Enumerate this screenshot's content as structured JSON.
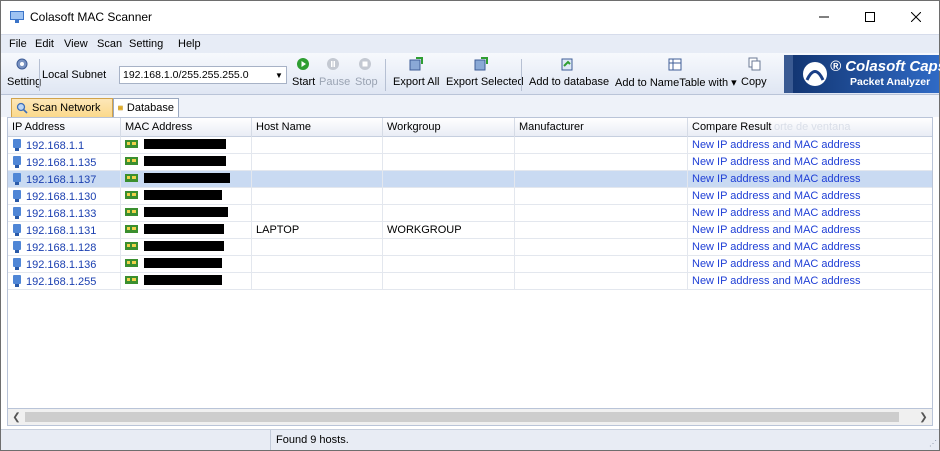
{
  "window": {
    "title": "Colasoft MAC Scanner"
  },
  "menu": [
    "File",
    "Edit",
    "View",
    "Scan",
    "Setting",
    "Help"
  ],
  "toolbar": {
    "setting": "Setting",
    "subnet_label": "Local Subnet",
    "subnet_value": "192.168.1.0/255.255.255.0",
    "start": "Start",
    "pause": "Pause",
    "stop": "Stop",
    "export_all": "Export All",
    "export_selected": "Export Selected",
    "add_db": "Add to database",
    "add_nametable": "Add to NameTable with ▾",
    "copy": "Copy"
  },
  "promo": {
    "brand": "® Colasoft Capsa",
    "tagline": "Packet Analyzer"
  },
  "tabs": [
    "Scan Network",
    "Database"
  ],
  "columns": [
    "IP Address",
    "MAC Address",
    "Host Name",
    "Workgroup",
    "Manufacturer",
    "Compare Result"
  ],
  "ghost_text": "orte de ventana",
  "rows": [
    {
      "ip": "192.168.1.1",
      "mac": "",
      "host": "",
      "workgroup": "",
      "manufacturer": "",
      "compare": "New IP address and MAC address"
    },
    {
      "ip": "192.168.1.135",
      "mac": "",
      "host": "",
      "workgroup": "",
      "manufacturer": "",
      "compare": "New IP address and MAC address"
    },
    {
      "ip": "192.168.1.137",
      "mac": "",
      "host": "",
      "workgroup": "",
      "manufacturer": "",
      "compare": "New IP address and MAC address",
      "selected": true
    },
    {
      "ip": "192.168.1.130",
      "mac": "",
      "host": "",
      "workgroup": "",
      "manufacturer": "",
      "compare": "New IP address and MAC address"
    },
    {
      "ip": "192.168.1.133",
      "mac": "",
      "host": "",
      "workgroup": "",
      "manufacturer": "",
      "compare": "New IP address and MAC address"
    },
    {
      "ip": "192.168.1.131",
      "mac": "",
      "host": "LAPTOP",
      "workgroup": "WORKGROUP",
      "manufacturer": "",
      "compare": "New IP address and MAC address"
    },
    {
      "ip": "192.168.1.128",
      "mac": "",
      "host": "",
      "workgroup": "",
      "manufacturer": "",
      "compare": "New IP address and MAC address"
    },
    {
      "ip": "192.168.1.136",
      "mac": "",
      "host": "",
      "workgroup": "",
      "manufacturer": "",
      "compare": "New IP address and MAC address"
    },
    {
      "ip": "192.168.1.255",
      "mac": "",
      "host": "",
      "workgroup": "",
      "manufacturer": "",
      "compare": "New IP address and MAC address"
    }
  ],
  "status": {
    "message": "Found 9 hosts."
  },
  "colors": {
    "selected_row": "#c9daf2",
    "link_blue": "#1f3fd6",
    "menubar": "#e7ecf6"
  }
}
